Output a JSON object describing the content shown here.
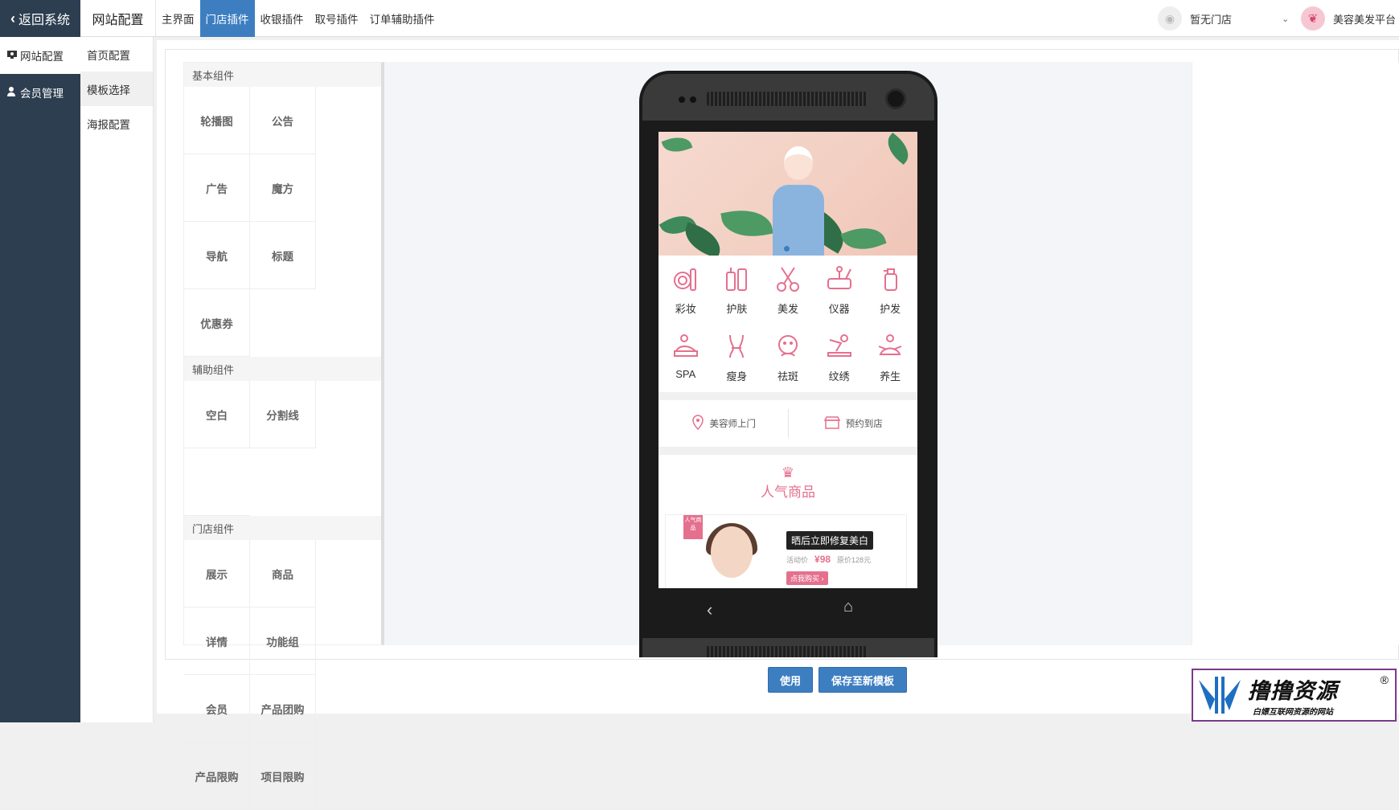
{
  "topbar": {
    "back_label": "返回系统",
    "site_config": "网站配置",
    "tabs": [
      {
        "label": "主界面"
      },
      {
        "label": "门店插件",
        "active": true
      },
      {
        "label": "收银插件"
      },
      {
        "label": "取号插件"
      },
      {
        "label": "订单辅助插件"
      }
    ],
    "store_name": "暂无门店",
    "platform_name": "美容美发平台"
  },
  "sidebar": {
    "items": [
      {
        "label": "网站配置",
        "icon": "monitor-icon",
        "active": true
      },
      {
        "label": "会员管理",
        "icon": "user-icon"
      }
    ]
  },
  "subnav": {
    "items": [
      {
        "label": "首页配置"
      },
      {
        "label": "模板选择",
        "active": true
      },
      {
        "label": "海报配置"
      }
    ]
  },
  "components": {
    "basic": {
      "title": "基本组件",
      "items": [
        "轮播图",
        "公告",
        "广告",
        "魔方",
        "导航",
        "标题",
        "优惠券"
      ]
    },
    "aux": {
      "title": "辅助组件",
      "items": [
        "空白",
        "分割线"
      ]
    },
    "store": {
      "title": "门店组件",
      "items": [
        "展示",
        "商品",
        "详情",
        "功能组",
        "会员",
        "产品团购",
        "产品限购",
        "项目限购"
      ]
    }
  },
  "phone": {
    "categories": [
      {
        "label": "彩妆",
        "icon": "makeup-icon"
      },
      {
        "label": "护肤",
        "icon": "skincare-icon"
      },
      {
        "label": "美发",
        "icon": "scissors-icon"
      },
      {
        "label": "仪器",
        "icon": "instrument-icon"
      },
      {
        "label": "护发",
        "icon": "haircare-icon"
      },
      {
        "label": "SPA",
        "icon": "spa-icon"
      },
      {
        "label": "瘦身",
        "icon": "slimming-icon"
      },
      {
        "label": "祛斑",
        "icon": "face-icon"
      },
      {
        "label": "纹绣",
        "icon": "tattoo-icon"
      },
      {
        "label": "养生",
        "icon": "wellness-icon"
      }
    ],
    "service_home": "美容师上门",
    "service_store": "预约到店",
    "hot_title": "人气商品",
    "ribbon": "人气商品",
    "promo_title": "晒后立即修复美白",
    "promo_price_label": "活动价",
    "promo_price": "¥98",
    "promo_original": "原价128元",
    "promo_buy": "点我购买 ›"
  },
  "actions": {
    "use": "使用",
    "save_new": "保存至新模板"
  },
  "watermark": {
    "big": "撸撸资源",
    "small": "白嫖互联网资源的网站",
    "reg": "®"
  },
  "colors": {
    "sidebar": "#2c3e50",
    "accent": "#3d7ec1",
    "pink": "#e5708e"
  }
}
